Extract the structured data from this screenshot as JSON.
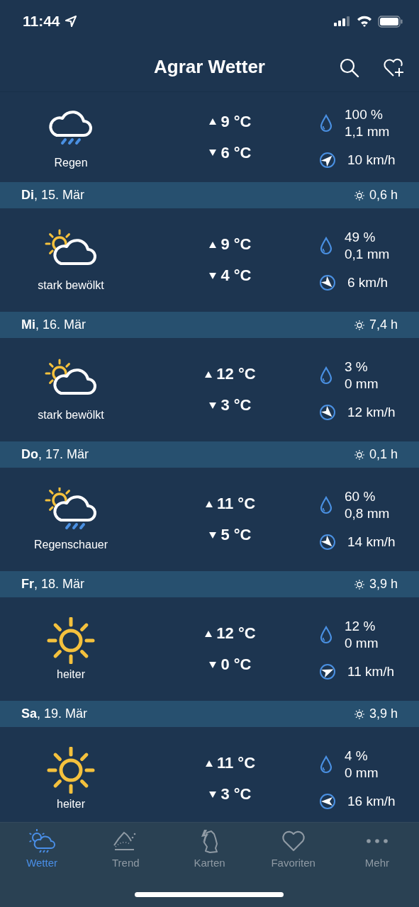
{
  "status_bar": {
    "time": "11:44"
  },
  "nav": {
    "title": "Agrar Wetter"
  },
  "days": [
    {
      "kind": "rain",
      "condition": "Regen",
      "high": "9 °C",
      "low": "6 °C",
      "rain_chance": "100 %",
      "rain_amount": "1,1 mm",
      "wind": {
        "kind": "ne",
        "speed": "10 km/h"
      }
    },
    {
      "header": {
        "date": "**Di**, 15. Mär",
        "sun": "0,6 h"
      },
      "kind": "cloudy",
      "condition": "stark bewölkt",
      "high": "9 °C",
      "low": "4 °C",
      "rain_chance": "49 %",
      "rain_amount": "0,1 mm",
      "wind": {
        "kind": "se",
        "speed": "6 km/h"
      }
    },
    {
      "header": {
        "date": "**Mi**, 16. Mär",
        "sun": "7,4 h"
      },
      "kind": "cloudy",
      "condition": "stark bewölkt",
      "high": "12 °C",
      "low": "3 °C",
      "rain_chance": "3 %",
      "rain_amount": "0 mm",
      "wind": {
        "kind": "se",
        "speed": "12 km/h"
      }
    },
    {
      "header": {
        "date": "**Do**, 17. Mär",
        "sun": "0,1 h"
      },
      "kind": "showers",
      "condition": "Regenschauer",
      "high": "11 °C",
      "low": "5 °C",
      "rain_chance": "60 %",
      "rain_amount": "0,8 mm",
      "wind": {
        "kind": "se",
        "speed": "14 km/h"
      }
    },
    {
      "header": {
        "date": "**Fr**, 18. Mär",
        "sun": "3,9 h"
      },
      "kind": "sunny",
      "condition": "heiter",
      "high": "12 °C",
      "low": "0 °C",
      "rain_chance": "12 %",
      "rain_amount": "0 mm",
      "wind": {
        "kind": "ene",
        "speed": "11 km/h"
      }
    },
    {
      "header": {
        "date": "**Sa**, 19. Mär",
        "sun": "3,9 h"
      },
      "kind": "sunny",
      "condition": "heiter",
      "high": "11 °C",
      "low": "3 °C",
      "rain_chance": "4 %",
      "rain_amount": "0 mm",
      "wind": {
        "kind": "w",
        "speed": "16 km/h"
      }
    }
  ],
  "tab_bar": [
    {
      "label": "Wetter",
      "selected": true
    },
    {
      "label": "Trend",
      "selected": false
    },
    {
      "label": "Karten",
      "selected": false
    },
    {
      "label": "Favoriten",
      "selected": false
    },
    {
      "label": "Mehr",
      "selected": false
    }
  ]
}
